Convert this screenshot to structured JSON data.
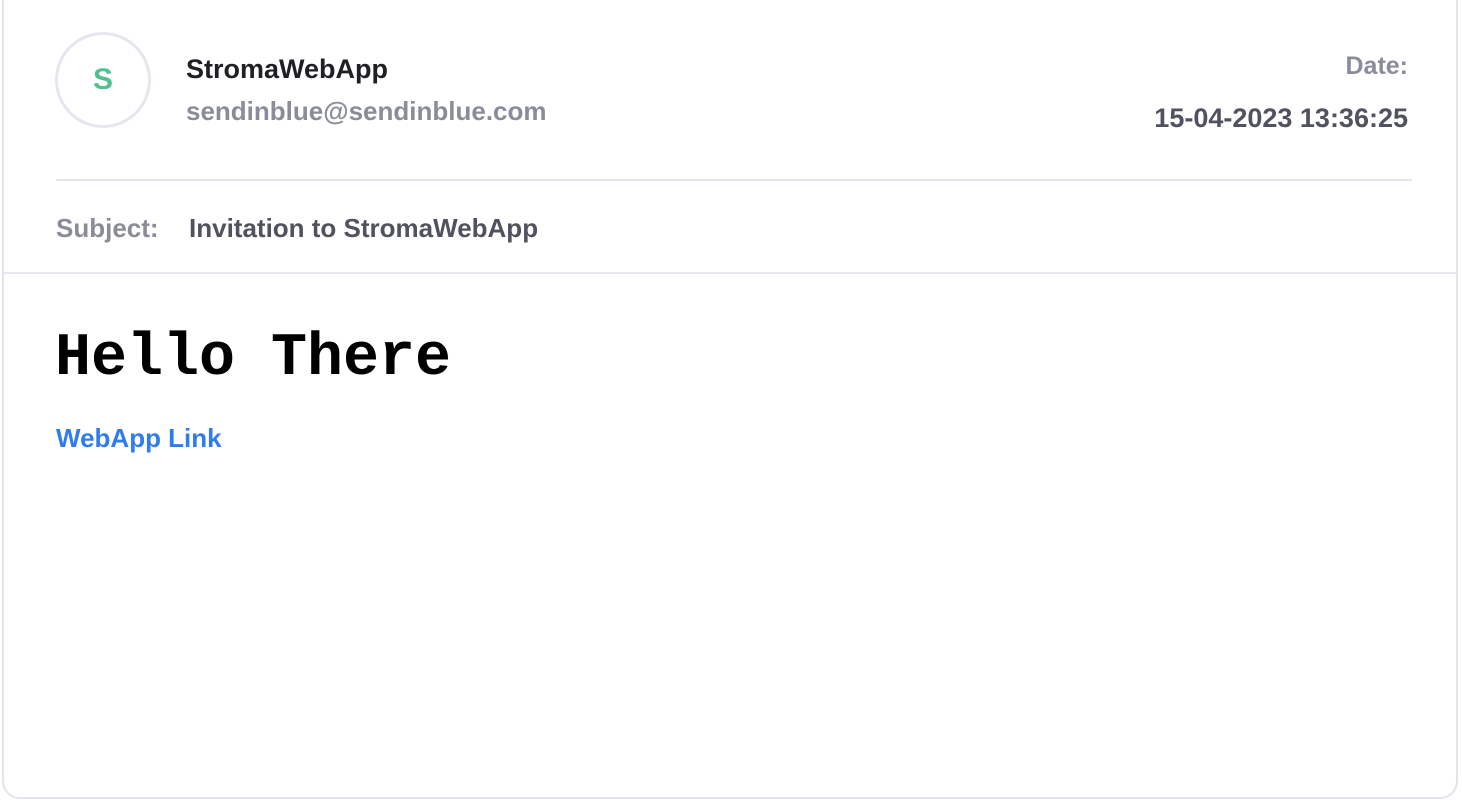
{
  "sender": {
    "avatar_initial": "S",
    "name": "StromaWebApp",
    "email": "sendinblue@sendinblue.com"
  },
  "date": {
    "label": "Date:",
    "value": "15-04-2023 13:36:25"
  },
  "subject": {
    "label": "Subject:",
    "value": "Invitation to StromaWebApp"
  },
  "body": {
    "heading": "Hello There",
    "link_text": "WebApp Link"
  },
  "colors": {
    "avatar_text": "#4fc38f",
    "link": "#2f7cf1",
    "muted_text": "#8a8d99",
    "border": "#e4e5ec"
  }
}
